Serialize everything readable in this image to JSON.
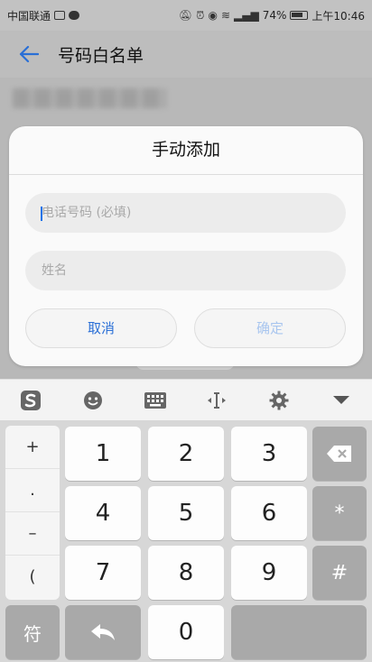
{
  "status_bar": {
    "carrier": "中国联通",
    "battery": "74%",
    "time": "上午10:46"
  },
  "app_bar": {
    "title": "号码白名单"
  },
  "dialog": {
    "title": "手动添加",
    "phone_placeholder": "电话号码 (必填)",
    "name_placeholder": "姓名",
    "cancel_label": "取消",
    "confirm_label": "确定"
  },
  "keyboard": {
    "symbols": [
      "+",
      ".",
      "–",
      "("
    ],
    "digits": [
      "1",
      "2",
      "3",
      "4",
      "5",
      "6",
      "7",
      "8",
      "9",
      "0"
    ],
    "star": "*",
    "hash": "#",
    "symbol_key": "符"
  },
  "colors": {
    "accent": "#2a6fd6",
    "confirm_disabled": "#a9c6ef"
  },
  "icons": [
    "back-arrow-icon",
    "sogou-logo-icon",
    "emoji-icon",
    "keyboard-icon",
    "cursor-move-icon",
    "gear-icon",
    "chevron-down-icon",
    "backspace-icon",
    "enter-arrow-icon"
  ]
}
